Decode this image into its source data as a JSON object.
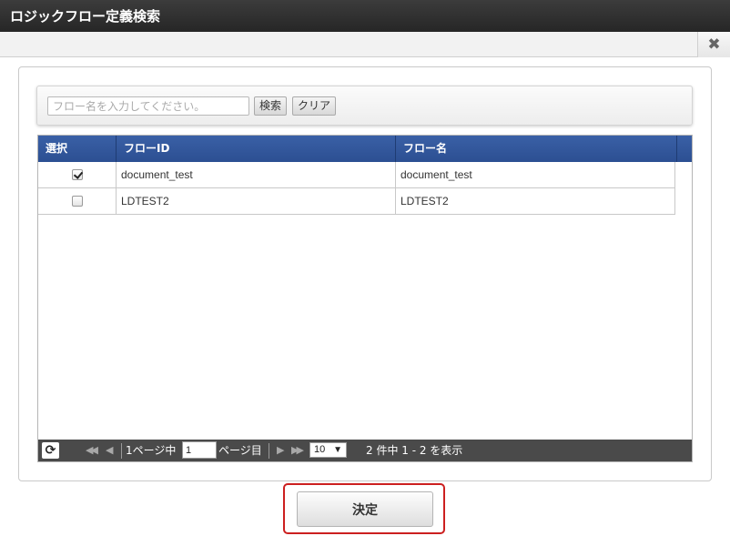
{
  "window": {
    "title": "ロジックフロー定義検索"
  },
  "toolbar": {
    "close_glyph": "✖",
    "close_icon": "close-icon"
  },
  "search": {
    "placeholder": "フロー名を入力してください。",
    "value": "",
    "search_label": "検索",
    "clear_label": "クリア"
  },
  "grid": {
    "columns": [
      "選択",
      "フローID",
      "フロー名"
    ],
    "rows": [
      {
        "selected": true,
        "flow_id": "document_test",
        "flow_name": "document_test"
      },
      {
        "selected": false,
        "flow_id": "LDTEST2",
        "flow_name": "LDTEST2"
      }
    ]
  },
  "pager": {
    "reload_glyph": "⟳",
    "first_glyph": "◀◀",
    "prev_glyph": "◀",
    "next_glyph": "▶",
    "last_glyph": "▶▶",
    "page_prefix": "1ページ中",
    "current_page": "1",
    "page_suffix": "ページ目",
    "per_page": "10",
    "dropdown_glyph": "▼",
    "summary": "2 件中 1 - 2 を表示"
  },
  "footer": {
    "confirm_label": "決定"
  },
  "colors": {
    "header_blue": "#2f539a",
    "highlight_red": "#cc1f1f",
    "titlebar": "#2d2d2d"
  }
}
